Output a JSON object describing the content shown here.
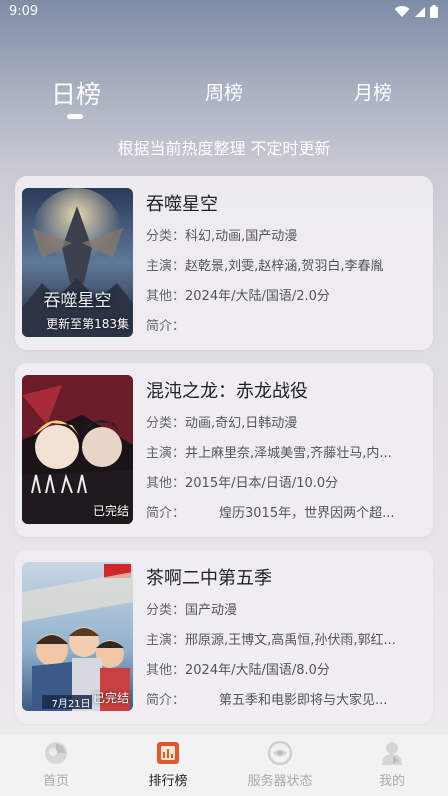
{
  "status": {
    "time": "9:09"
  },
  "tabs": [
    {
      "label": "日榜"
    },
    {
      "label": "周榜"
    },
    {
      "label": "月榜"
    }
  ],
  "subtitle": "根据当前热度整理 不定时更新",
  "labels": {
    "category": "分类：",
    "cast": "主演：",
    "other": "其他：",
    "intro": "简介："
  },
  "items": [
    {
      "title": "吞噬星空",
      "category": "科幻,动画,国产动漫",
      "cast": "赵乾景,刘雯,赵梓涵,贺羽白,李春胤",
      "other": "2024年/大陆/国语/2.0分",
      "intro": "",
      "badge": "更新至第183集",
      "poster_text": "吞噬星空",
      "poster_colors": [
        "#2a3a5a",
        "#8a97b0",
        "#c6b090"
      ]
    },
    {
      "title": "混沌之龙：赤龙战役",
      "category": "动画,奇幻,日韩动漫",
      "cast": "井上麻里奈,泽城美雪,齐藤壮马,内...",
      "other": "2015年/日本/日语/10.0分",
      "intro": "煌历3015年，世界因两个超...",
      "badge": "已完结",
      "poster_text": "",
      "poster_colors": [
        "#1a1418",
        "#7a2030",
        "#e8d8c8"
      ]
    },
    {
      "title": "茶啊二中第五季",
      "category": "国产动漫",
      "cast": "邢原源,王博文,高禹恒,孙伏雨,郭红...",
      "other": "2024年/大陆/国语/8.0分",
      "intro": "第五季和电影即将与大家见...",
      "badge": "已完结",
      "poster_text": "7月21日",
      "poster_colors": [
        "#5c8fb8",
        "#b8c8d8",
        "#c03030"
      ]
    }
  ],
  "nav": [
    {
      "label": "首页",
      "icon": "home-icon"
    },
    {
      "label": "排行榜",
      "icon": "ranking-icon"
    },
    {
      "label": "服务器状态",
      "icon": "server-status-icon"
    },
    {
      "label": "我的",
      "icon": "profile-icon"
    }
  ]
}
